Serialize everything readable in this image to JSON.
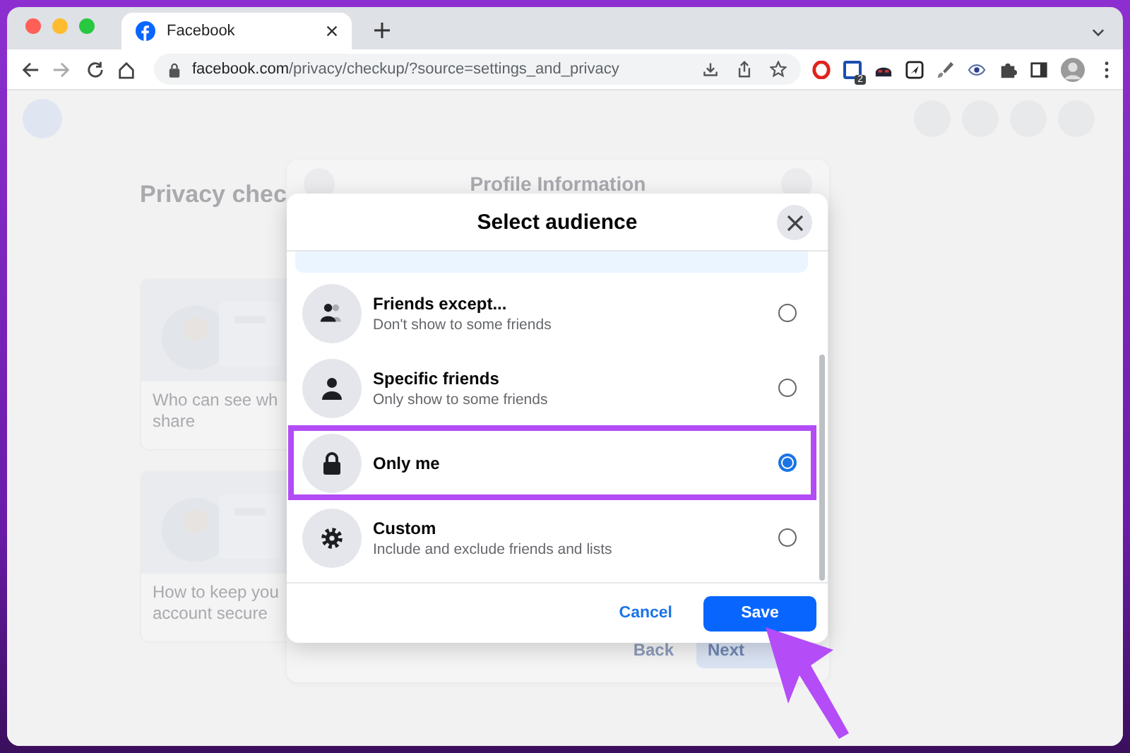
{
  "browser": {
    "tab": {
      "title": "Facebook"
    },
    "url": {
      "host": "facebook.com",
      "path": "/privacy/checkup/?source=settings_and_privacy"
    },
    "extension_badge": "2"
  },
  "background_page": {
    "heading": "Privacy chec",
    "cards": [
      {
        "lines": [
          "Who can see wh",
          "share"
        ]
      },
      {
        "lines": [
          "How to keep you",
          "account secure"
        ]
      }
    ],
    "dialog_title": "Profile Information",
    "back_button": "Back",
    "next_button": "Next"
  },
  "dialog": {
    "title": "Select audience",
    "options": [
      {
        "kind": "friends-except",
        "title": "Friends except...",
        "subtitle": "Don't show to some friends",
        "selected": false,
        "highlighted": false
      },
      {
        "kind": "specific-friends",
        "title": "Specific friends",
        "subtitle": "Only show to some friends",
        "selected": false,
        "highlighted": false
      },
      {
        "kind": "only-me",
        "title": "Only me",
        "selected": true,
        "highlighted": true
      },
      {
        "kind": "custom",
        "title": "Custom",
        "subtitle": "Include and exclude friends and lists",
        "selected": false,
        "highlighted": false
      }
    ],
    "cancel_button": "Cancel",
    "save_button": "Save"
  }
}
